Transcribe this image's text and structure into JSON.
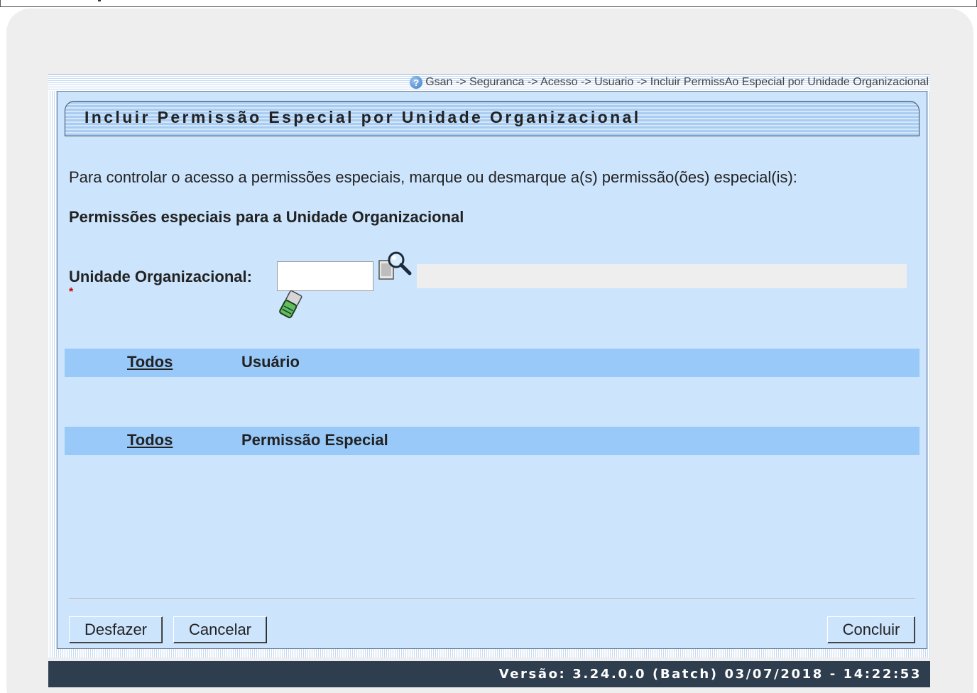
{
  "breadcrumb": {
    "text": "Gsan -> Seguranca -> Acesso -> Usuario -> Incluir PermissAo Especial por Unidade Organizacional"
  },
  "form": {
    "title": "Incluir Permissão Especial por Unidade Organizacional",
    "instructions": "Para controlar o acesso a permissões especiais, marque ou desmarque a(s) permissão(ões) especial(is):",
    "section_title": "Permissões especiais para a Unidade Organizacional",
    "unit_label": "Unidade Organizacional:",
    "required_mark": "*",
    "unit_value": "",
    "unit_description": ""
  },
  "users_list": {
    "select_all_label": "Todos",
    "column_label": "Usuário",
    "rows": []
  },
  "permissions_list": {
    "select_all_label": "Todos",
    "column_label": "Permissão Especial",
    "rows": []
  },
  "buttons": {
    "undo": "Desfazer",
    "cancel": "Cancelar",
    "conclude": "Concluir"
  },
  "footer": {
    "version": "Versão: 3.24.0.0 (Batch) 03/07/2018 - 14:22:53"
  },
  "colors": {
    "panel_bg": "#cce4fc",
    "header_row_bg": "#99c9f9",
    "footer_bg": "#2f3e4f",
    "required": "#d00000"
  },
  "icons": {
    "help": "help-icon",
    "search": "magnifier-icon",
    "clear": "eraser-icon"
  }
}
